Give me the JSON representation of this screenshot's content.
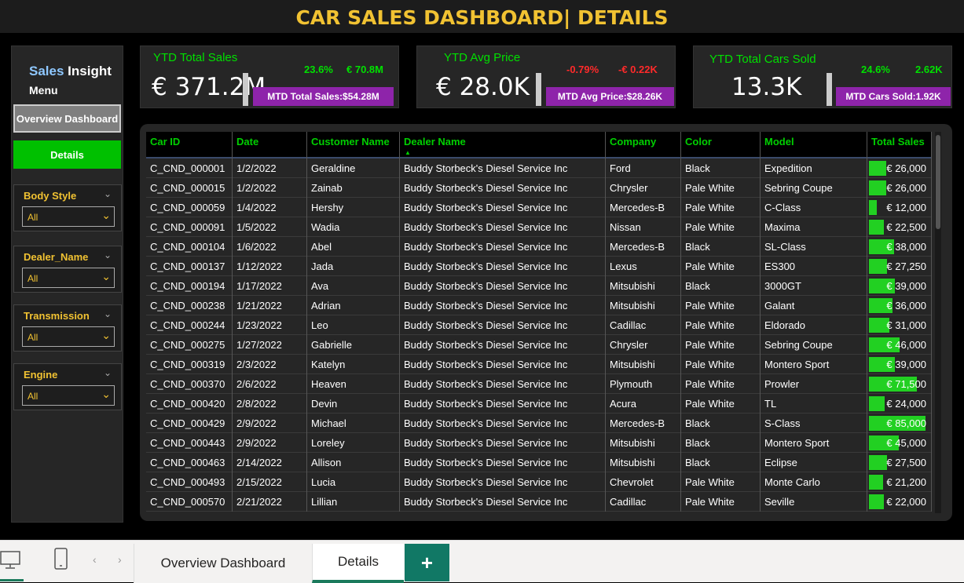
{
  "title": "CAR SALES DASHBOARD| DETAILS",
  "sidebar": {
    "brand_highlight": "Sales",
    "brand_rest": " Insight",
    "menu_label": "Menu",
    "nav": [
      {
        "label": "Overview Dashboard"
      },
      {
        "label": "Details"
      }
    ],
    "slicers": [
      {
        "title": "Body Style",
        "value": "All"
      },
      {
        "title": "Dealer_Name",
        "value": "All"
      },
      {
        "title": "Transmission",
        "value": "All"
      },
      {
        "title": "Engine",
        "value": "All"
      }
    ]
  },
  "kpis": [
    {
      "title": "YTD Total Sales",
      "value": "€ 371.2M",
      "pct": "23.6%",
      "amount": "€ 70.8M",
      "badge": "MTD Total Sales:$54.28M",
      "pct_color": "#00e000",
      "amount_color": "#00e000"
    },
    {
      "title": "YTD Avg Price",
      "value": "€ 28.0K",
      "pct": "-0.79%",
      "amount": "-€ 0.22K",
      "badge": "MTD Avg Price:$28.26K",
      "pct_color": "#ff2a2a",
      "amount_color": "#ff2a2a"
    },
    {
      "title": "YTD Total Cars Sold",
      "value": "13.3K",
      "pct": "24.6%",
      "amount": "2.62K",
      "badge": "MTD Cars Sold:1.92K",
      "pct_color": "#00e000",
      "amount_color": "#00e000"
    }
  ],
  "table": {
    "columns": [
      "Car ID",
      "Date",
      "Customer Name",
      "Dealer Name",
      "Company",
      "Color",
      "Model",
      "Total Sales"
    ],
    "rows": [
      [
        "C_CND_000001",
        "1/2/2022",
        "Geraldine",
        "Buddy Storbeck's Diesel Service Inc",
        "Ford",
        "Black",
        "Expedition",
        "€ 26,000"
      ],
      [
        "C_CND_000015",
        "1/2/2022",
        "Zainab",
        "Buddy Storbeck's Diesel Service Inc",
        "Chrysler",
        "Pale White",
        "Sebring Coupe",
        "€ 26,000"
      ],
      [
        "C_CND_000059",
        "1/4/2022",
        "Hershy",
        "Buddy Storbeck's Diesel Service Inc",
        "Mercedes-B",
        "Pale White",
        "C-Class",
        "€ 12,000"
      ],
      [
        "C_CND_000091",
        "1/5/2022",
        "Wadia",
        "Buddy Storbeck's Diesel Service Inc",
        "Nissan",
        "Pale White",
        "Maxima",
        "€ 22,500"
      ],
      [
        "C_CND_000104",
        "1/6/2022",
        "Abel",
        "Buddy Storbeck's Diesel Service Inc",
        "Mercedes-B",
        "Black",
        "SL-Class",
        "€ 38,000"
      ],
      [
        "C_CND_000137",
        "1/12/2022",
        "Jada",
        "Buddy Storbeck's Diesel Service Inc",
        "Lexus",
        "Pale White",
        "ES300",
        "€ 27,250"
      ],
      [
        "C_CND_000194",
        "1/17/2022",
        "Ava",
        "Buddy Storbeck's Diesel Service Inc",
        "Mitsubishi",
        "Black",
        "3000GT",
        "€ 39,000"
      ],
      [
        "C_CND_000238",
        "1/21/2022",
        "Adrian",
        "Buddy Storbeck's Diesel Service Inc",
        "Mitsubishi",
        "Pale White",
        "Galant",
        "€ 36,000"
      ],
      [
        "C_CND_000244",
        "1/23/2022",
        "Leo",
        "Buddy Storbeck's Diesel Service Inc",
        "Cadillac",
        "Pale White",
        "Eldorado",
        "€ 31,000"
      ],
      [
        "C_CND_000275",
        "1/27/2022",
        "Gabrielle",
        "Buddy Storbeck's Diesel Service Inc",
        "Chrysler",
        "Pale White",
        "Sebring Coupe",
        "€ 46,000"
      ],
      [
        "C_CND_000319",
        "2/3/2022",
        "Katelyn",
        "Buddy Storbeck's Diesel Service Inc",
        "Mitsubishi",
        "Pale White",
        "Montero Sport",
        "€ 39,000"
      ],
      [
        "C_CND_000370",
        "2/6/2022",
        "Heaven",
        "Buddy Storbeck's Diesel Service Inc",
        "Plymouth",
        "Pale White",
        "Prowler",
        "€ 71,500"
      ],
      [
        "C_CND_000420",
        "2/8/2022",
        "Devin",
        "Buddy Storbeck's Diesel Service Inc",
        "Acura",
        "Pale White",
        "TL",
        "€ 24,000"
      ],
      [
        "C_CND_000429",
        "2/9/2022",
        "Michael",
        "Buddy Storbeck's Diesel Service Inc",
        "Mercedes-B",
        "Black",
        "S-Class",
        "€ 85,000"
      ],
      [
        "C_CND_000443",
        "2/9/2022",
        "Loreley",
        "Buddy Storbeck's Diesel Service Inc",
        "Mitsubishi",
        "Black",
        "Montero Sport",
        "€ 45,000"
      ],
      [
        "C_CND_000463",
        "2/14/2022",
        "Allison",
        "Buddy Storbeck's Diesel Service Inc",
        "Mitsubishi",
        "Black",
        "Eclipse",
        "€ 27,500"
      ],
      [
        "C_CND_000493",
        "2/15/2022",
        "Lucia",
        "Buddy Storbeck's Diesel Service Inc",
        "Chevrolet",
        "Pale White",
        "Monte Carlo",
        "€ 21,200"
      ],
      [
        "C_CND_000570",
        "2/21/2022",
        "Lillian",
        "Buddy Storbeck's Diesel Service Inc",
        "Cadillac",
        "Pale White",
        "Seville",
        "€ 22,000"
      ]
    ],
    "sales_values": [
      26000,
      26000,
      12000,
      22500,
      38000,
      27250,
      39000,
      36000,
      31000,
      46000,
      39000,
      71500,
      24000,
      85000,
      45000,
      27500,
      21200,
      22000
    ],
    "sales_max": 85000,
    "bar_color": "#22d022"
  },
  "tabs": [
    {
      "label": "Overview Dashboard",
      "active": false
    },
    {
      "label": "Details",
      "active": true
    }
  ],
  "add_tab_label": "+"
}
